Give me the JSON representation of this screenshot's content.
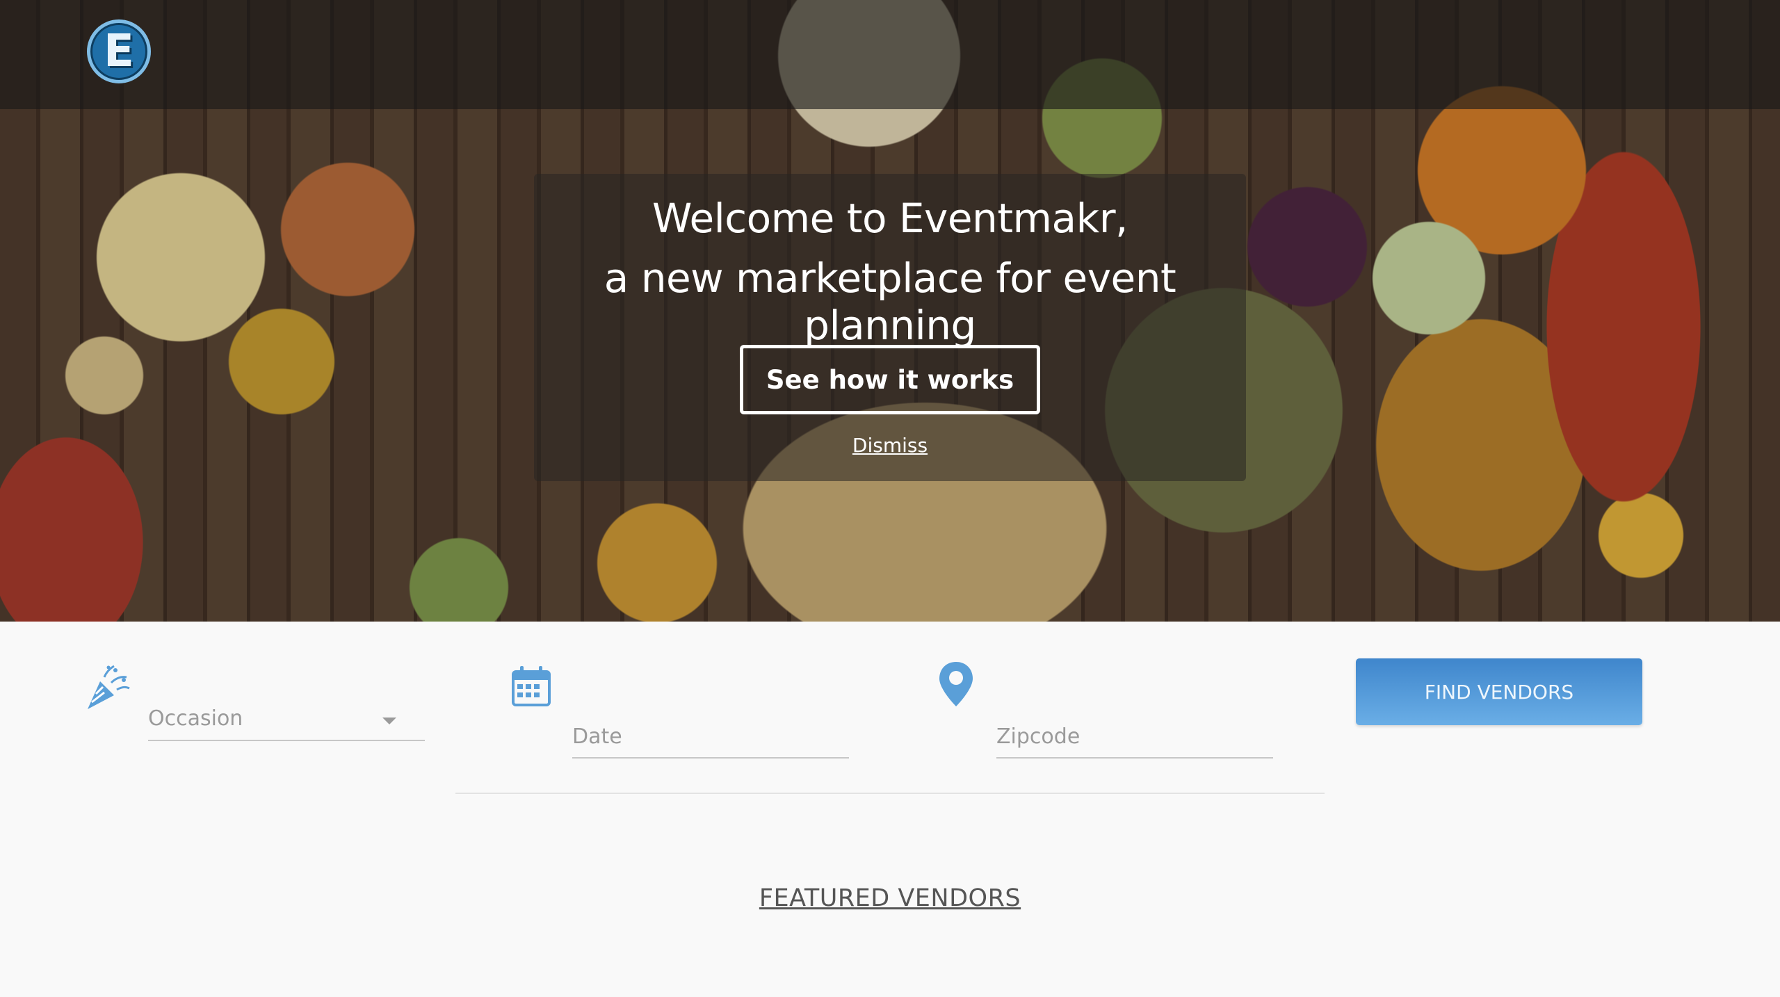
{
  "header": {
    "logo_letter": "E"
  },
  "welcome": {
    "line1": "Welcome to Eventmakr,",
    "line2": "a new marketplace for event planning",
    "cta_label": "See how it works",
    "dismiss_label": "Dismiss"
  },
  "search": {
    "occasion_placeholder": "Occasion",
    "date_placeholder": "Date",
    "zipcode_placeholder": "Zipcode",
    "find_button_label": "FIND VENDORS"
  },
  "sections": {
    "featured_title": "FEATURED VENDORS"
  },
  "colors": {
    "accent": "#4a90d6",
    "icon_blue": "#5a9fd8"
  }
}
